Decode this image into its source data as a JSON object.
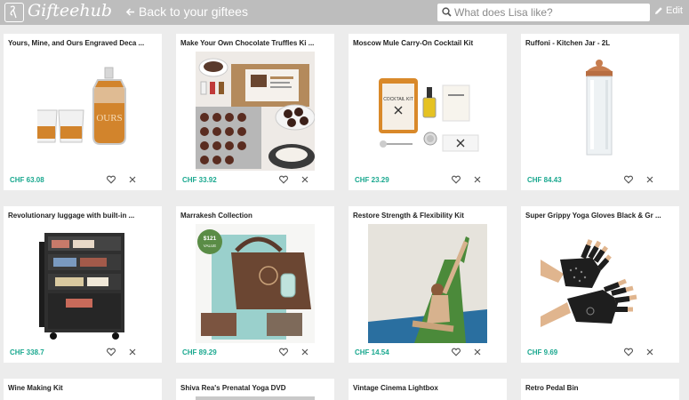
{
  "header": {
    "logo_text": "Gifteehub",
    "back_label": "Back to your giftees",
    "search_placeholder": "What does Lisa like?",
    "edit_label": "Edit"
  },
  "products": [
    {
      "title": "Yours, Mine, and Ours Engraved Deca ...",
      "price": "CHF 63.08",
      "decanter_text": "OURS"
    },
    {
      "title": "Make Your Own Chocolate Truffles Ki ...",
      "price": "CHF 33.92"
    },
    {
      "title": "Moscow Mule Carry-On Cocktail Kit",
      "price": "CHF 23.29",
      "kit_text": "COCKTAIL KIT"
    },
    {
      "title": "Ruffoni - Kitchen Jar - 2L",
      "price": "CHF 84.43"
    },
    {
      "title": "Revolutionary luggage with built-in ...",
      "price": "CHF 338.7"
    },
    {
      "title": "Marrakesh Collection",
      "price": "CHF 89.29",
      "badge_amount": "$121",
      "badge_value": "VALUE"
    },
    {
      "title": "Restore Strength & Flexibility Kit",
      "price": "CHF 14.54"
    },
    {
      "title": "Super Grippy Yoga Gloves Black & Gr ...",
      "price": "CHF 9.69"
    },
    {
      "title": "Wine Making Kit",
      "price": ""
    },
    {
      "title": "Shiva Rea's Prenatal Yoga DVD",
      "price": ""
    },
    {
      "title": "Vintage Cinema Lightbox",
      "price": ""
    },
    {
      "title": "Retro Pedal Bin",
      "price": ""
    }
  ],
  "colors": {
    "header_bg": "#bdbdbd",
    "page_bg": "#ececec",
    "price": "#1aa88f"
  }
}
